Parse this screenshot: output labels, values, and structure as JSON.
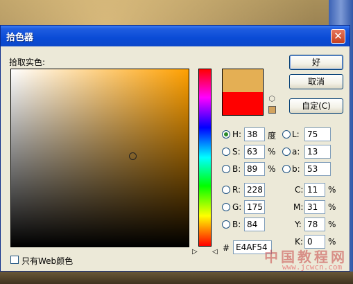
{
  "dialog": {
    "title": "拾色器",
    "close_glyph": "✕",
    "pick_label": "拾取实色:",
    "buttons": {
      "ok": "好",
      "cancel": "取消",
      "custom": "自定(C)"
    },
    "web_only_label": "只有Web颜色",
    "web_only_checked": false,
    "new_color": "#E4AF54",
    "current_color": "#FF0000",
    "selected_mode": "H",
    "hsb": [
      {
        "label": "H:",
        "value": "38",
        "unit": "度"
      },
      {
        "label": "S:",
        "value": "63",
        "unit": "%"
      },
      {
        "label": "B:",
        "value": "89",
        "unit": "%"
      }
    ],
    "rgb": [
      {
        "label": "R:",
        "value": "228"
      },
      {
        "label": "G:",
        "value": "175"
      },
      {
        "label": "B:",
        "value": "84"
      }
    ],
    "lab": [
      {
        "label": "L:",
        "value": "75"
      },
      {
        "label": "a:",
        "value": "13"
      },
      {
        "label": "b:",
        "value": "53"
      }
    ],
    "cmyk": [
      {
        "label": "C:",
        "value": "11",
        "unit": "%"
      },
      {
        "label": "M:",
        "value": "31",
        "unit": "%"
      },
      {
        "label": "Y:",
        "value": "78",
        "unit": "%"
      },
      {
        "label": "K:",
        "value": "0",
        "unit": "%"
      }
    ],
    "hex_label": "#",
    "hex_value": "E4AF54"
  },
  "watermark": {
    "text": "中国教程网",
    "url": "www.jcwcn.com"
  },
  "icons": {
    "cube": "cube-icon",
    "slider_arrow": "triangle-icon"
  }
}
